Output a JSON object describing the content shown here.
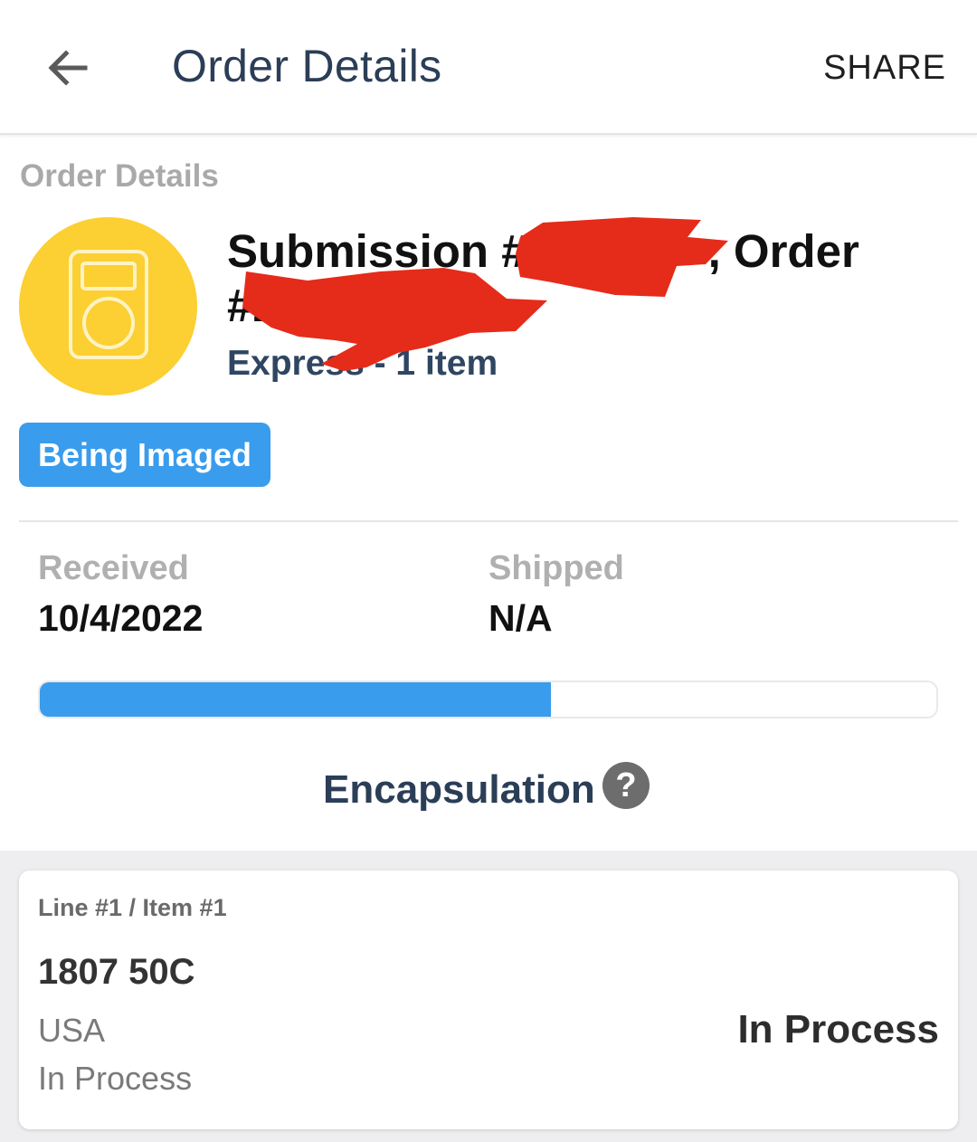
{
  "appbar": {
    "title": "Order Details",
    "share_label": "SHARE",
    "back_icon": "arrow-left-icon"
  },
  "order": {
    "section_label": "Order Details",
    "avatar_icon": "coin-holder-icon",
    "avatar_color": "#fccf32",
    "submission_line1": "Submission #",
    "submission_line1_tail": ", Order",
    "submission_line2": "#2",
    "meta": "Express - 1 item",
    "status_badge": "Being Imaged",
    "accent_color": "#3a9cec"
  },
  "dates": {
    "received_label": "Received",
    "received_value": "10/4/2022",
    "shipped_label": "Shipped",
    "shipped_value": "N/A"
  },
  "progress": {
    "percent": 57
  },
  "stage": {
    "label": "Encapsulation",
    "help_icon": "question-mark-icon",
    "help_glyph": "?"
  },
  "items": [
    {
      "line_label": "Line #1 / Item #1",
      "name": "1807 50C",
      "country": "USA",
      "status_sub": "In Process",
      "status": "In Process"
    }
  ]
}
